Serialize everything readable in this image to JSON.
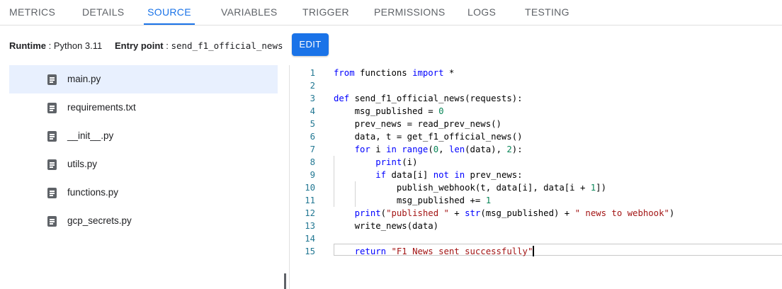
{
  "tabs": [
    {
      "label": "METRICS",
      "active": false
    },
    {
      "label": "DETAILS",
      "active": false
    },
    {
      "label": "SOURCE",
      "active": true
    },
    {
      "label": "VARIABLES",
      "active": false
    },
    {
      "label": "TRIGGER",
      "active": false
    },
    {
      "label": "PERMISSIONS",
      "active": false
    },
    {
      "label": "LOGS",
      "active": false
    },
    {
      "label": "TESTING",
      "active": false
    }
  ],
  "toolbar": {
    "runtime_label": "Runtime",
    "runtime_value": "Python 3.11",
    "entry_label": "Entry point",
    "entry_value": "send_f1_official_news",
    "edit_label": "EDIT"
  },
  "files": [
    {
      "name": "main.py",
      "selected": true,
      "icon": "file-icon"
    },
    {
      "name": "requirements.txt",
      "selected": false,
      "icon": "file-icon"
    },
    {
      "name": "__init__.py",
      "selected": false,
      "icon": "file-icon"
    },
    {
      "name": "utils.py",
      "selected": false,
      "icon": "file-icon"
    },
    {
      "name": "functions.py",
      "selected": false,
      "icon": "file-icon"
    },
    {
      "name": "gcp_secrets.py",
      "selected": false,
      "icon": "file-icon"
    }
  ],
  "code": {
    "current_line": 15,
    "lines": [
      [
        [
          "kw",
          "from"
        ],
        [
          "t",
          " functions "
        ],
        [
          "kw",
          "import"
        ],
        [
          "t",
          " *"
        ]
      ],
      [],
      [
        [
          "kw",
          "def"
        ],
        [
          "t",
          " send_f1_official_news(requests):"
        ]
      ],
      [
        [
          "t",
          "    msg_published = "
        ],
        [
          "num",
          "0"
        ]
      ],
      [
        [
          "t",
          "    prev_news = read_prev_news()"
        ]
      ],
      [
        [
          "t",
          "    data, t = get_f1_official_news()"
        ]
      ],
      [
        [
          "t",
          "    "
        ],
        [
          "kw",
          "for"
        ],
        [
          "t",
          " i "
        ],
        [
          "kw",
          "in"
        ],
        [
          "t",
          " "
        ],
        [
          "kw",
          "range"
        ],
        [
          "t",
          "("
        ],
        [
          "num",
          "0"
        ],
        [
          "t",
          ", "
        ],
        [
          "kw",
          "len"
        ],
        [
          "t",
          "(data), "
        ],
        [
          "num",
          "2"
        ],
        [
          "t",
          "):"
        ]
      ],
      [
        [
          "t",
          "        "
        ],
        [
          "kw",
          "print"
        ],
        [
          "t",
          "(i)"
        ]
      ],
      [
        [
          "t",
          "        "
        ],
        [
          "kw",
          "if"
        ],
        [
          "t",
          " data[i] "
        ],
        [
          "kw",
          "not"
        ],
        [
          "t",
          " "
        ],
        [
          "kw",
          "in"
        ],
        [
          "t",
          " prev_news:"
        ]
      ],
      [
        [
          "t",
          "            publish_webhook(t, data[i], data[i + "
        ],
        [
          "num",
          "1"
        ],
        [
          "t",
          "])"
        ]
      ],
      [
        [
          "t",
          "            msg_published += "
        ],
        [
          "num",
          "1"
        ]
      ],
      [
        [
          "t",
          "    "
        ],
        [
          "kw",
          "print"
        ],
        [
          "t",
          "("
        ],
        [
          "str",
          "\"published \""
        ],
        [
          "t",
          " + "
        ],
        [
          "kw",
          "str"
        ],
        [
          "t",
          "(msg_published) + "
        ],
        [
          "str",
          "\" news to webhook\""
        ],
        [
          "t",
          ")"
        ]
      ],
      [
        [
          "t",
          "    write_news(data)"
        ]
      ],
      [],
      [
        [
          "t",
          "    "
        ],
        [
          "kw",
          "return"
        ],
        [
          "t",
          " "
        ],
        [
          "str",
          "\"F1 News sent successfully\""
        ]
      ]
    ]
  },
  "colors": {
    "accent": "#1a73e8",
    "selected_bg": "#e8f0fe",
    "keyword": "#0000ff",
    "string": "#a31515",
    "number": "#098658",
    "line_number": "#237893"
  }
}
